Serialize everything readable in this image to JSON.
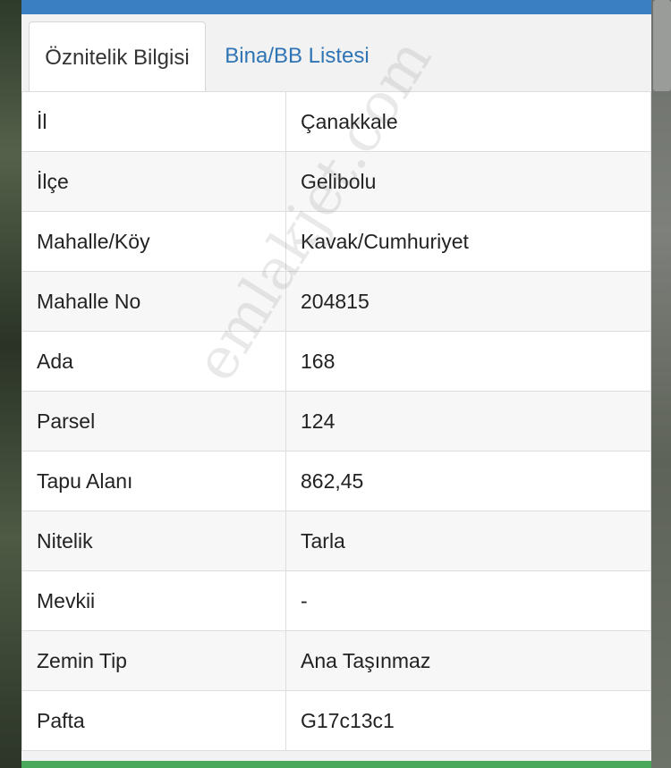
{
  "tabs": [
    {
      "label": "Öznitelik Bilgisi",
      "active": true
    },
    {
      "label": "Bina/BB Listesi",
      "active": false
    }
  ],
  "attributes": [
    {
      "key": "İl",
      "value": "Çanakkale"
    },
    {
      "key": "İlçe",
      "value": "Gelibolu"
    },
    {
      "key": "Mahalle/Köy",
      "value": "Kavak/Cumhuriyet"
    },
    {
      "key": "Mahalle No",
      "value": "204815"
    },
    {
      "key": "Ada",
      "value": "168"
    },
    {
      "key": "Parsel",
      "value": "124"
    },
    {
      "key": "Tapu Alanı",
      "value": "862,45"
    },
    {
      "key": "Nitelik",
      "value": "Tarla"
    },
    {
      "key": "Mevkii",
      "value": "-"
    },
    {
      "key": "Zemin Tip",
      "value": "Ana Taşınmaz"
    },
    {
      "key": "Pafta",
      "value": "G17c13c1"
    }
  ],
  "watermark": "emlakjet.com",
  "colors": {
    "header_bar": "#3a7fc1",
    "tab_link": "#2f74b5",
    "footer_bar": "#4aa85a"
  }
}
